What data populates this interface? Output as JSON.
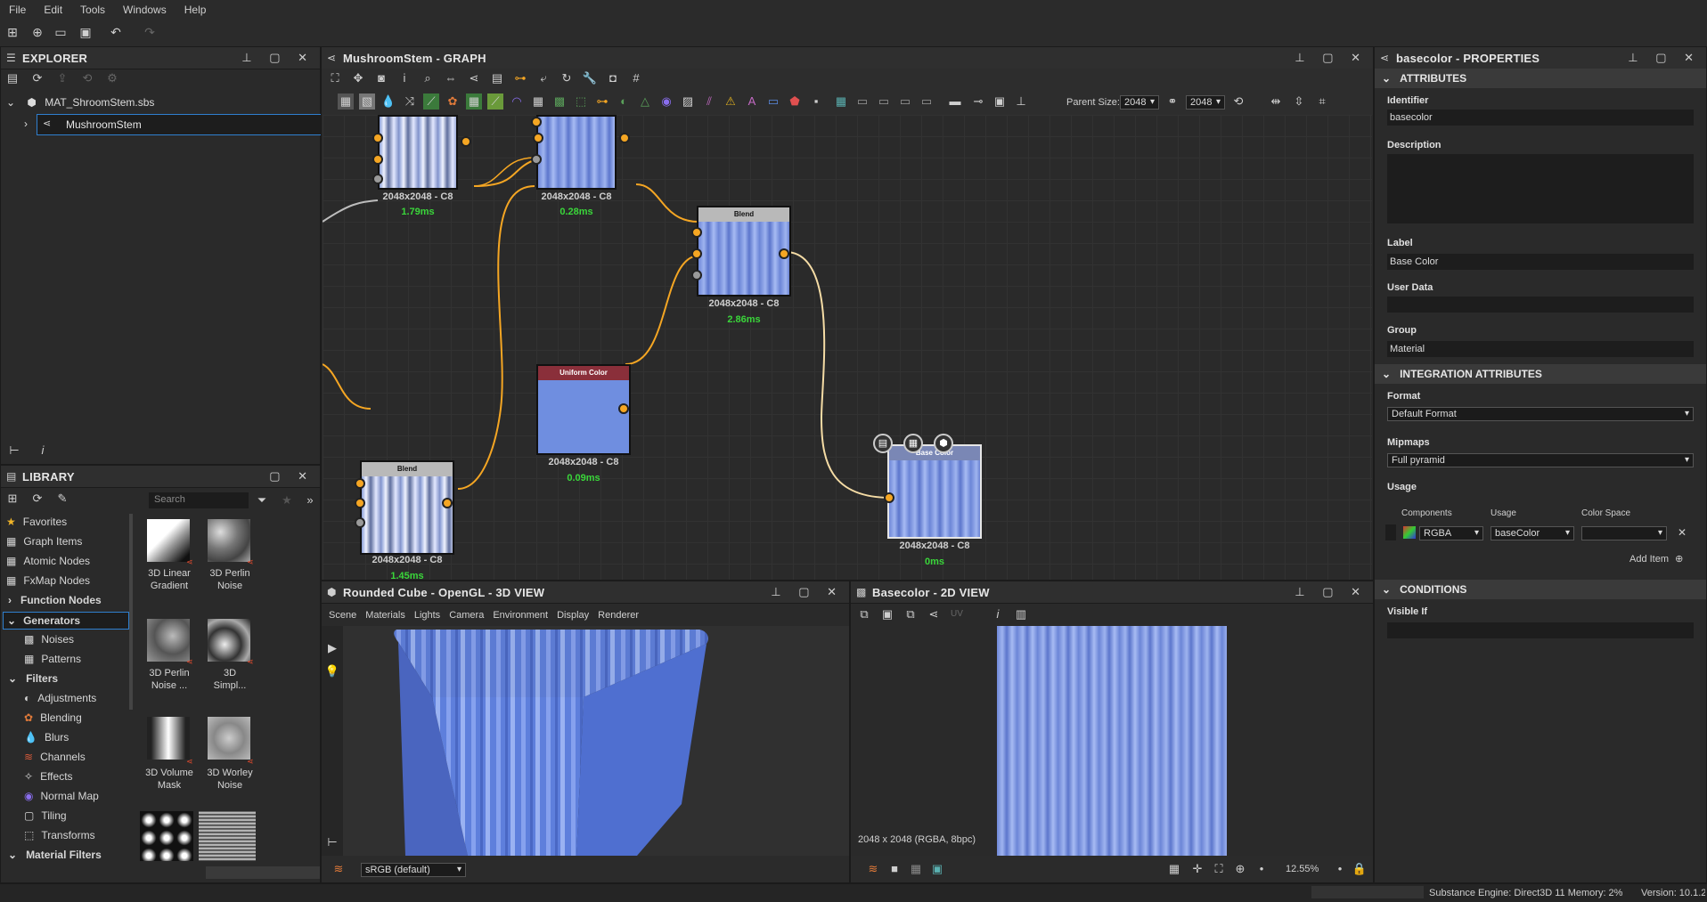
{
  "menu": [
    "File",
    "Edit",
    "Tools",
    "Windows",
    "Help"
  ],
  "explorer": {
    "title": "EXPLORER",
    "package": "MAT_ShroomStem.sbs",
    "graph": "MushroomStem"
  },
  "graph_panel": {
    "title": "MushroomStem - GRAPH",
    "parent_size_label": "Parent Size:",
    "parent_size_value": "2048",
    "size_value": "2048",
    "nodes": [
      {
        "label": "2048x2048 - C8",
        "time": "1.79ms"
      },
      {
        "label": "2048x2048 - C8",
        "time": "0.28ms"
      },
      {
        "label": "2048x2048 - C8",
        "time": "2.86ms",
        "header": "Blend"
      },
      {
        "label": "2048x2048 - C8",
        "time": "0.09ms",
        "header": "Uniform Color"
      },
      {
        "label": "2048x2048 - C8",
        "time": "1.45ms",
        "header": "Blend"
      },
      {
        "label": "2048x2048 - C8",
        "time": "0ms",
        "header": "Base Color"
      }
    ]
  },
  "properties": {
    "title": "basecolor - PROPERTIES",
    "sections": {
      "attributes": "ATTRIBUTES",
      "integration": "INTEGRATION ATTRIBUTES",
      "conditions": "CONDITIONS"
    },
    "identifier_label": "Identifier",
    "identifier": "basecolor",
    "description_label": "Description",
    "label_label": "Label",
    "label": "Base Color",
    "userdata_label": "User Data",
    "group_label": "Group",
    "group": "Material",
    "format_label": "Format",
    "format": "Default Format",
    "mipmaps_label": "Mipmaps",
    "mipmaps": "Full pyramid",
    "usage_label": "Usage",
    "col_components": "Components",
    "col_usage": "Usage",
    "col_colorspace": "Color Space",
    "components": "RGBA",
    "usage_value": "baseColor",
    "colorspace": "",
    "add_item": "Add Item",
    "visible_if_label": "Visible If"
  },
  "library": {
    "title": "LIBRARY",
    "search_placeholder": "Search",
    "items": [
      {
        "label": "Favorites",
        "bold": false
      },
      {
        "label": "Graph Items",
        "bold": false
      },
      {
        "label": "Atomic Nodes",
        "bold": false
      },
      {
        "label": "FxMap Nodes",
        "bold": false
      },
      {
        "label": "Function Nodes",
        "bold": true
      },
      {
        "label": "Generators",
        "bold": true
      },
      {
        "label": "Noises",
        "bold": false
      },
      {
        "label": "Patterns",
        "bold": false
      },
      {
        "label": "Filters",
        "bold": true
      },
      {
        "label": "Adjustments",
        "bold": false
      },
      {
        "label": "Blending",
        "bold": false
      },
      {
        "label": "Blurs",
        "bold": false
      },
      {
        "label": "Channels",
        "bold": false
      },
      {
        "label": "Effects",
        "bold": false
      },
      {
        "label": "Normal Map",
        "bold": false
      },
      {
        "label": "Tiling",
        "bold": false
      },
      {
        "label": "Transforms",
        "bold": false
      },
      {
        "label": "Material Filters",
        "bold": true
      }
    ],
    "thumbs": [
      {
        "l1": "3D Linear",
        "l2": "Gradient"
      },
      {
        "l1": "3D Perlin",
        "l2": "Noise"
      },
      {
        "l1": "3D Perlin",
        "l2": "Noise ..."
      },
      {
        "l1": "3D",
        "l2": "Simpl..."
      },
      {
        "l1": "3D Volume",
        "l2": "Mask"
      },
      {
        "l1": "3D Worley",
        "l2": "Noise"
      }
    ]
  },
  "view3d": {
    "title": "Rounded Cube - OpenGL - 3D VIEW",
    "menu": [
      "Scene",
      "Materials",
      "Lights",
      "Camera",
      "Environment",
      "Display",
      "Renderer"
    ],
    "colorspace": "sRGB (default)"
  },
  "view2d": {
    "title": "Basecolor - 2D VIEW",
    "uv": "UV",
    "info": "2048 x 2048 (RGBA, 8bpc)",
    "zoom": "12.55%"
  },
  "statusbar": {
    "engine": "Substance Engine: Direct3D 11  Memory: 2%",
    "version": "Version: 10.1.2"
  }
}
